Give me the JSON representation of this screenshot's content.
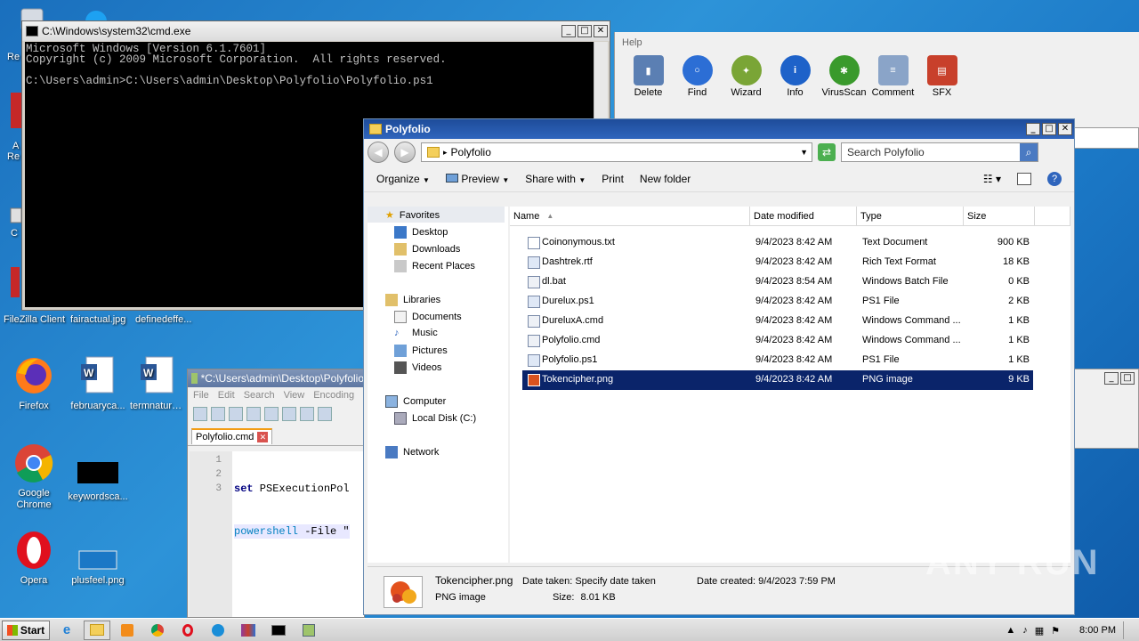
{
  "desktop": {
    "icons_top": [
      "FileZilla Client",
      "fairactual.jpg",
      "definedeffe..."
    ],
    "icons_grid": [
      {
        "label": "Firefox",
        "icon": "firefox-icon"
      },
      {
        "label": "februaryca...",
        "icon": "word-doc-icon"
      },
      {
        "label": "termnatura...",
        "icon": "word-doc-icon"
      },
      {
        "label": "Google Chrome",
        "icon": "chrome-icon"
      },
      {
        "label": "keywordsca...",
        "icon": "black-image-icon"
      },
      {
        "label": "Opera",
        "icon": "opera-icon"
      },
      {
        "label": "plusfeel.png",
        "icon": "image-icon"
      }
    ],
    "left_partial": [
      "Re",
      "A",
      "Re",
      "C"
    ]
  },
  "cmd": {
    "title": "C:\\Windows\\system32\\cmd.exe",
    "lines": [
      "Microsoft Windows [Version 6.1.7601]",
      "Copyright (c) 2009 Microsoft Corporation.  All rights reserved.",
      "",
      "C:\\Users\\admin>C:\\Users\\admin\\Desktop\\Polyfolio\\Polyfolio.ps1"
    ]
  },
  "rar": {
    "menu": "Help",
    "buttons": [
      {
        "label": "Delete",
        "icon": "trash-icon",
        "color": "#5b7fb3"
      },
      {
        "label": "Find",
        "icon": "magnifier-icon",
        "color": "#2c6ed5"
      },
      {
        "label": "Wizard",
        "icon": "wand-icon",
        "color": "#7aa536"
      },
      {
        "label": "Info",
        "icon": "info-icon",
        "color": "#1e62c9"
      },
      {
        "label": "VirusScan",
        "icon": "bug-icon",
        "color": "#3a9a2c"
      },
      {
        "label": "Comment",
        "icon": "comment-icon",
        "color": "#8aa4c8"
      },
      {
        "label": "SFX",
        "icon": "sfx-box-icon",
        "color": "#c8402b"
      }
    ]
  },
  "notepad": {
    "title": "*C:\\Users\\admin\\Desktop\\Polyfolio",
    "menu": [
      "File",
      "Edit",
      "Search",
      "View",
      "Encoding"
    ],
    "tab": "Polyfolio.cmd",
    "lines": [
      {
        "num": "1",
        "kw": "set",
        "rest": " PSExecutionPol"
      },
      {
        "num": "2",
        "kw": "powershell",
        "rest": " -File \""
      },
      {
        "num": "3",
        "kw": "",
        "rest": ""
      }
    ]
  },
  "explorer": {
    "title": "Polyfolio",
    "address": "Polyfolio",
    "search_placeholder": "Search Polyfolio",
    "commands": [
      "Organize",
      "Preview",
      "Share with",
      "Print",
      "New folder"
    ],
    "nav": {
      "favorites": "Favorites",
      "fav_items": [
        "Desktop",
        "Downloads",
        "Recent Places"
      ],
      "libraries": "Libraries",
      "lib_items": [
        "Documents",
        "Music",
        "Pictures",
        "Videos"
      ],
      "computer": "Computer",
      "drive": "Local Disk (C:)",
      "network": "Network"
    },
    "columns": [
      "Name",
      "Date modified",
      "Type",
      "Size"
    ],
    "files": [
      {
        "name": "Coinonymous.txt",
        "date": "9/4/2023 8:42 AM",
        "type": "Text Document",
        "size": "900 KB"
      },
      {
        "name": "Dashtrek.rtf",
        "date": "9/4/2023 8:42 AM",
        "type": "Rich Text Format",
        "size": "18 KB"
      },
      {
        "name": "dl.bat",
        "date": "9/4/2023 8:54 AM",
        "type": "Windows Batch File",
        "size": "0 KB"
      },
      {
        "name": "Durelux.ps1",
        "date": "9/4/2023 8:42 AM",
        "type": "PS1 File",
        "size": "2 KB"
      },
      {
        "name": "DureluxA.cmd",
        "date": "9/4/2023 8:42 AM",
        "type": "Windows Command ...",
        "size": "1 KB"
      },
      {
        "name": "Polyfolio.cmd",
        "date": "9/4/2023 8:42 AM",
        "type": "Windows Command ...",
        "size": "1 KB"
      },
      {
        "name": "Polyfolio.ps1",
        "date": "9/4/2023 8:42 AM",
        "type": "PS1 File",
        "size": "1 KB"
      },
      {
        "name": "Tokencipher.png",
        "date": "9/4/2023 8:42 AM",
        "type": "PNG image",
        "size": "9 KB"
      }
    ],
    "selected_index": 7,
    "details": {
      "name": "Tokencipher.png",
      "type": "PNG image",
      "date_taken_label": "Date taken:",
      "date_taken_value": "Specify date taken",
      "size_label": "Size:",
      "size_value": "8.01 KB",
      "date_created_label": "Date created:",
      "date_created_value": "9/4/2023 7:59 PM"
    }
  },
  "taskbar": {
    "start": "Start",
    "clock": "8:00 PM"
  },
  "watermark": "ANY RUN"
}
